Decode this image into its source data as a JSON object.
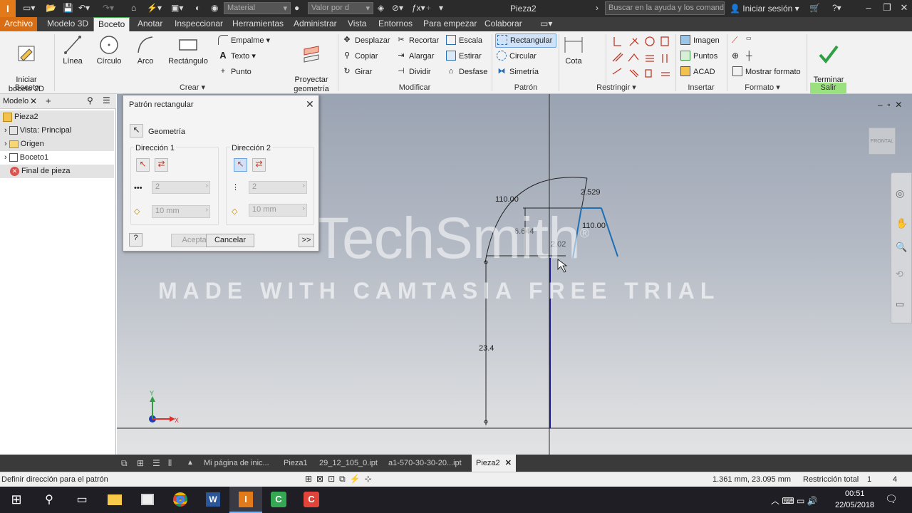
{
  "titlebar": {
    "doc_title": "Pieza2",
    "material": "Material",
    "appearance": "Valor por d",
    "search_placeholder": "Buscar en la ayuda y los comandos",
    "signin": "Iniciar sesión"
  },
  "menu": {
    "archivo": "Archivo",
    "tabs": [
      "Modelo 3D",
      "Boceto",
      "Anotar",
      "Inspeccionar",
      "Herramientas",
      "Administrar",
      "Vista",
      "Entornos",
      "Para empezar",
      "Colaborar"
    ]
  },
  "ribbon": {
    "boceto_panel": {
      "label": "Boceto",
      "iniciar": "Iniciar\nboceto 2D"
    },
    "crear_panel": {
      "label": "Crear",
      "linea": "Línea",
      "circulo": "Círculo",
      "arco": "Arco",
      "rectangulo": "Rectángulo",
      "empalme": "Empalme",
      "texto": "Texto",
      "punto": "Punto",
      "proyectar": "Proyectar\ngeometría"
    },
    "modificar_panel": {
      "label": "Modificar",
      "desplazar": "Desplazar",
      "copiar": "Copiar",
      "girar": "Girar",
      "recortar": "Recortar",
      "alargar": "Alargar",
      "dividir": "Dividir",
      "escala": "Escala",
      "estirar": "Estirar",
      "desfase": "Desfase"
    },
    "patron_panel": {
      "label": "Patrón",
      "rectangular": "Rectangular",
      "circular": "Circular",
      "simetria": "Simetría"
    },
    "cota_panel": {
      "cota": "Cota"
    },
    "restringir_panel": {
      "label": "Restringir"
    },
    "insertar_panel": {
      "label": "Insertar",
      "imagen": "Imagen",
      "puntos": "Puntos",
      "acad": "ACAD"
    },
    "formato_panel": {
      "label": "Formato",
      "mostrar": "Mostrar formato"
    },
    "salir_panel": {
      "label": "Salir",
      "terminar": "Terminar\nboceto"
    }
  },
  "browser": {
    "tab": "Modelo",
    "items": [
      "Pieza2",
      "Vista: Principal",
      "Origen",
      "Boceto1",
      "Final de pieza"
    ]
  },
  "dialog": {
    "title": "Patrón rectangular",
    "geometria": "Geometría",
    "dir1": "Dirección 1",
    "dir2": "Dirección 2",
    "count1": "2",
    "dist1": "10 mm",
    "count2": "2",
    "dist2": "10 mm",
    "aceptar": "Aceptar",
    "cancelar": "Cancelar",
    "more": ">>"
  },
  "canvas": {
    "dims": [
      "110.00",
      "2.529",
      "110.00",
      "6.644",
      "2.02",
      "23.4"
    ],
    "viewcube": "FRONTAL",
    "watermark1": "TechSmith",
    "watermark_reg": "®",
    "watermark2": "MADE WITH CAMTASIA FREE TRIAL"
  },
  "bottom_tabs": [
    "Mi página de inic...",
    "Pieza1",
    "29_12_105_0.ipt",
    "a1-570-30-30-20...ipt",
    "Pieza2"
  ],
  "status": {
    "message": "Definir dirección para el patrón",
    "coords": "1.361 mm, 23.095 mm",
    "restriccion": "Restricción total",
    "v1": "1",
    "v2": "4"
  },
  "taskbar": {
    "time": "00:51",
    "date": "22/05/2018"
  }
}
